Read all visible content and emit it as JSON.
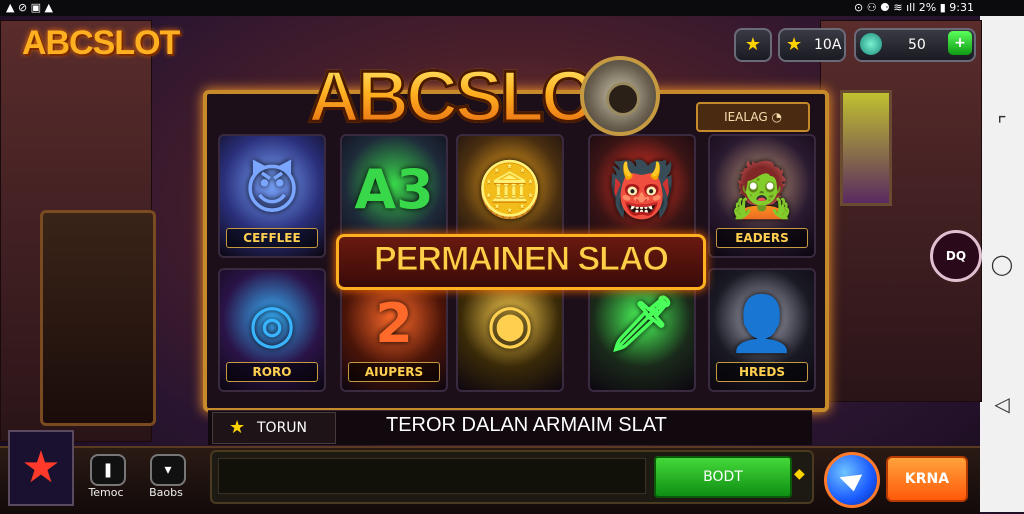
{
  "status": {
    "left_icons": "▲ ⊘ ▣ ▲",
    "right_text": "⊙ ⚇ ⚈ ≋ ıll 2% ▮ 9:31"
  },
  "header": {
    "logo": "ABCSLOT",
    "star_chip_value": "10A",
    "coins_value": "50",
    "plus": "+",
    "star_chip_icon": "★"
  },
  "main": {
    "game_logo": "ABCSLOT",
    "top_right_tag": "IEALAG ◔",
    "banner": "PERMAINEN SLAO",
    "tiles": [
      {
        "label": "CEFFLEE",
        "bg": "#2a2f7a",
        "accent": "#7aa6ff",
        "glyph": "😈"
      },
      {
        "label": "",
        "bg": "#1e2a3a",
        "accent": "#39d84a",
        "glyph": "A3"
      },
      {
        "label": "",
        "bg": "#4a2f10",
        "accent": "#ffb020",
        "glyph": "🪙"
      },
      {
        "label": "",
        "bg": "#3a1414",
        "accent": "#ff3a2a",
        "glyph": "👹"
      },
      {
        "label": "EADERS",
        "bg": "#2a1a30",
        "accent": "#c49a7a",
        "glyph": "🧟"
      },
      {
        "label": "RORO",
        "bg": "#2a1448",
        "accent": "#39b4ff",
        "glyph": "◎"
      },
      {
        "label": "AIUPERS",
        "bg": "#4a1408",
        "accent": "#ff6a2a",
        "glyph": "2"
      },
      {
        "label": "",
        "bg": "#3a2a08",
        "accent": "#ffd050",
        "glyph": "◉"
      },
      {
        "label": "",
        "bg": "#1a2a1a",
        "accent": "#4aff5a",
        "glyph": "🗡"
      },
      {
        "label": "HREDS",
        "bg": "#1a1a24",
        "accent": "#b4b4c4",
        "glyph": "👤"
      }
    ]
  },
  "info": {
    "tab_label": "TORUN",
    "tab_icon": "★",
    "message": "TEROR DALAN ARMAIM SLAT"
  },
  "bottom": {
    "star_icon": "★",
    "btn1_label": "Temoc",
    "btn2_label": "Baobs",
    "green_button": "BODT",
    "orange_button": "KRNA",
    "side_glyph": "◆"
  },
  "right_panel": {
    "bubble": "DQ"
  },
  "nav": {
    "top": "⌜",
    "mid": "◯",
    "bottom": "◁"
  }
}
